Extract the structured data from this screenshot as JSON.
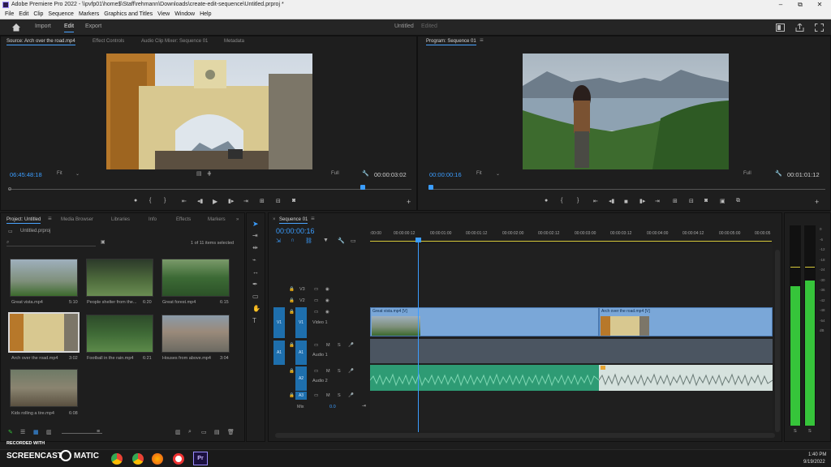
{
  "window": {
    "title": "Adobe Premiere Pro 2022 - \\\\pvfp01\\home$\\Staff\\rehmann\\Downloads\\create-edit-sequence\\Untitled.prproj *",
    "minimize": "–",
    "maximize": "⧉",
    "close": "✕"
  },
  "menu": [
    "File",
    "Edit",
    "Clip",
    "Sequence",
    "Markers",
    "Graphics and Titles",
    "View",
    "Window",
    "Help"
  ],
  "workspace": {
    "tabs": [
      "Import",
      "Edit",
      "Export"
    ],
    "project_name": "Untitled",
    "state": "Edited"
  },
  "source_panel": {
    "tabs": [
      "Source: Arch over the road.mp4",
      "Effect Controls",
      "Audio Clip Mixer: Sequence 01",
      "Metadata"
    ],
    "timecode": "06:45:48:18",
    "fit": "Fit",
    "quality": "Full",
    "duration": "00:00:03:02"
  },
  "program_panel": {
    "tab": "Program: Sequence 01",
    "timecode": "00:00:00:16",
    "fit": "Fit",
    "quality": "Full",
    "duration": "00:01:01:12"
  },
  "project_panel": {
    "tabs": [
      "Project: Untitled",
      "Media Browser",
      "Libraries",
      "Info",
      "Effects",
      "Markers"
    ],
    "file": "Untitled.prproj",
    "items_selected": "1 of 11 items selected",
    "clips": [
      {
        "name": "Great vista.mp4",
        "duration": "5:10"
      },
      {
        "name": "People shelter from the...",
        "duration": "6:20"
      },
      {
        "name": "Great forest.mp4",
        "duration": "6:15"
      },
      {
        "name": "Arch over the road.mp4",
        "duration": "3:02"
      },
      {
        "name": "Football in the rain.mp4",
        "duration": "6:21"
      },
      {
        "name": "Houses from above.mp4",
        "duration": "3:04"
      },
      {
        "name": "Kids rolling a tire.mp4",
        "duration": "6:08"
      }
    ]
  },
  "timeline": {
    "tab": "Sequence 01",
    "timecode": "00:00:00:16",
    "ruler": [
      ":00:00",
      "00:00:00:12",
      "00:00:01:00",
      "00:00:01:12",
      "00:00:02:00",
      "00:00:02:12",
      "00:00:03:00",
      "00:00:03:12",
      "00:00:04:00",
      "00:00:04:12",
      "00:00:05:00",
      "00:00:05"
    ],
    "tracks": {
      "v3": "V3",
      "v2": "V2",
      "v1": "V1",
      "video1": "Video 1",
      "a1": "A1",
      "audio1": "Audio 1",
      "a2": "A2",
      "audio2": "Audio 2",
      "a3": "A3",
      "mix": "Mix",
      "mix_value": "0.0"
    },
    "clips": {
      "v1a": "Great vista.mp4 [V]",
      "v1b": "Arch over the road.mp4 [V]"
    },
    "m": "M",
    "s": "S"
  },
  "meters": [
    "0",
    "-6",
    "-12",
    "-18",
    "-24",
    "-30",
    "-36",
    "-42",
    "-48",
    "-54",
    "dB"
  ],
  "meter_labels": [
    "S",
    "S"
  ],
  "taskbar": {
    "recorder": "RECORDED WITH",
    "brand": "SCREENCAST",
    "brand2": "MATIC",
    "time": "1:40 PM",
    "date": "9/19/2022"
  },
  "colors": {
    "accent": "#3b9dff",
    "video_clip": "#7aa7d8",
    "audio_clip": "#2e9b74",
    "meter": "#36c43a"
  }
}
